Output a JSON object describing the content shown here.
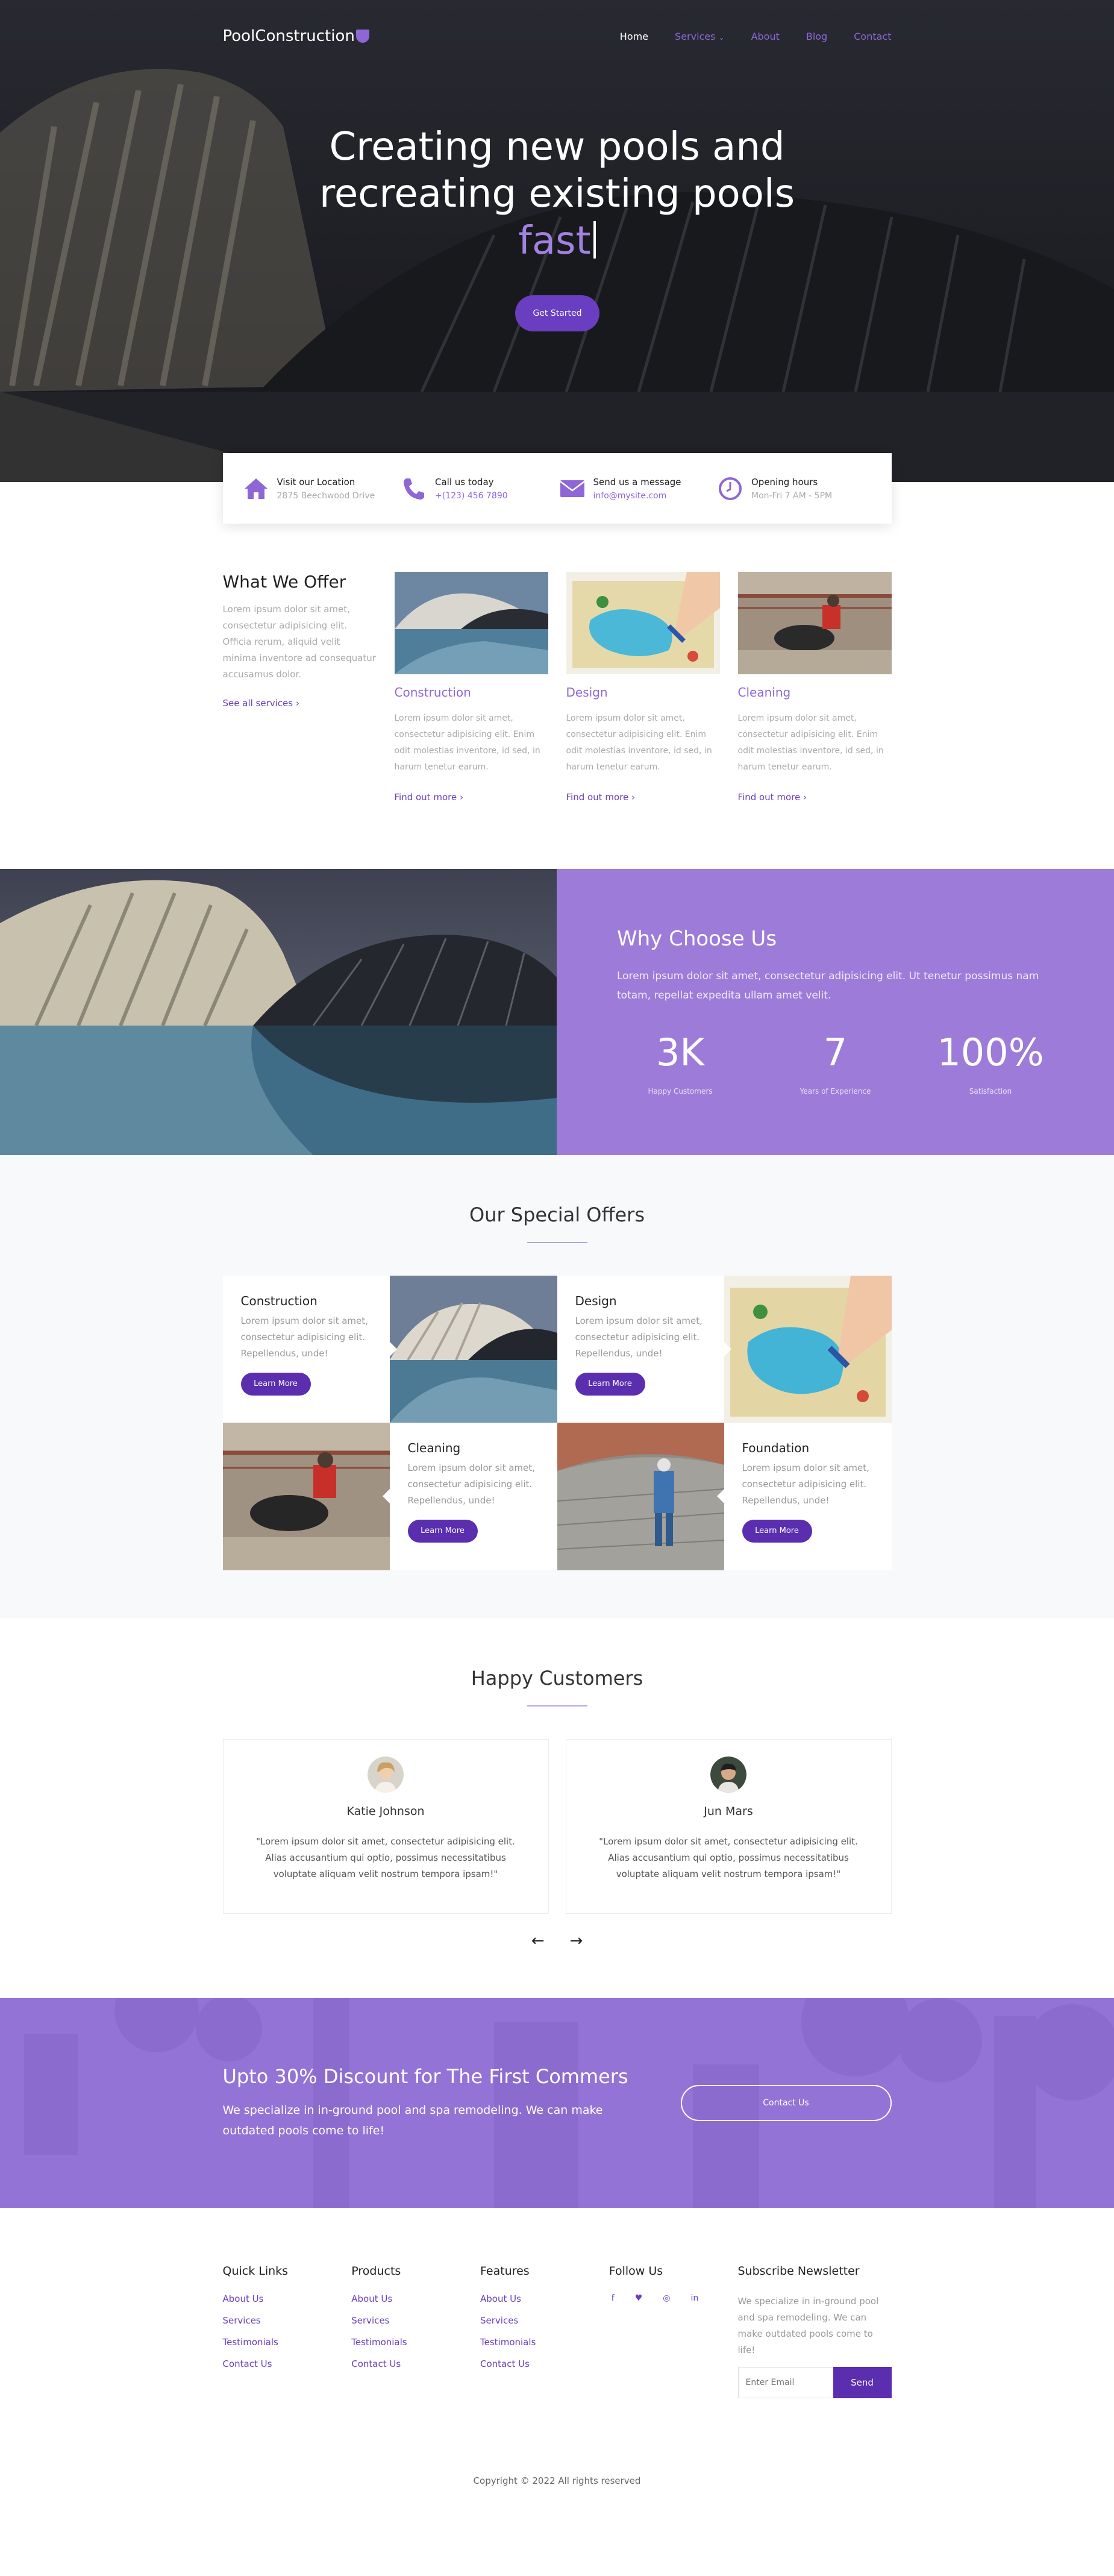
{
  "nav": {
    "logo": "PoolConstruction",
    "links": [
      {
        "label": "Home"
      },
      {
        "label": "Services"
      },
      {
        "label": "About"
      },
      {
        "label": "Blog"
      },
      {
        "label": "Contact"
      }
    ]
  },
  "hero": {
    "title_line1": "Creating new pools and",
    "title_line2": "recreating existing pools",
    "typed_word": "fast",
    "button": "Get Started"
  },
  "info_bar": [
    {
      "title": "Visit our Location",
      "sub": "2875 Beechwood Drive",
      "icon": "home-icon"
    },
    {
      "title": "Call us today",
      "sub": "+(123) 456 7890",
      "icon": "phone-icon"
    },
    {
      "title": "Send us a message",
      "sub": "info@mysite.com",
      "icon": "envelope-icon"
    },
    {
      "title": "Opening hours",
      "sub": "Mon-Fri 7 AM - 5PM",
      "icon": "clock-icon"
    }
  ],
  "offer": {
    "title": "What We Offer",
    "text": "Lorem ipsum dolor sit amet, consectetur adipisicing elit. Officia rerum, aliquid velit minima inventore ad consequatur accusamus dolor.",
    "link": "See all services",
    "services": [
      {
        "title": "Construction",
        "text": "Lorem ipsum dolor sit amet, consectetur adipisicing elit. Enim odit molestias inventore, id sed, in harum tenetur earum.",
        "link": "Find out more"
      },
      {
        "title": "Design",
        "text": "Lorem ipsum dolor sit amet, consectetur adipisicing elit. Enim odit molestias inventore, id sed, in harum tenetur earum.",
        "link": "Find out more"
      },
      {
        "title": "Cleaning",
        "text": "Lorem ipsum dolor sit amet, consectetur adipisicing elit. Enim odit molestias inventore, id sed, in harum tenetur earum.",
        "link": "Find out more"
      }
    ]
  },
  "why": {
    "title": "Why Choose Us",
    "text": "Lorem ipsum dolor sit amet, consectetur adipisicing elit. Ut tenetur possimus nam totam, repellat expedita ullam amet velit.",
    "stats": [
      {
        "value": "3K",
        "label": "Happy Customers"
      },
      {
        "value": "7",
        "label": "Years of Experience"
      },
      {
        "value": "100%",
        "label": "Satisfaction"
      }
    ]
  },
  "special": {
    "title": "Our Special Offers",
    "items": [
      {
        "title": "Construction",
        "text": "Lorem ipsum dolor sit amet, consectetur adipisicing elit. Repellendus, unde!",
        "button": "Learn More"
      },
      {
        "title": "Design",
        "text": "Lorem ipsum dolor sit amet, consectetur adipisicing elit. Repellendus, unde!",
        "button": "Learn More"
      },
      {
        "title": "Cleaning",
        "text": "Lorem ipsum dolor sit amet, consectetur adipisicing elit. Repellendus, unde!",
        "button": "Learn More"
      },
      {
        "title": "Foundation",
        "text": "Lorem ipsum dolor sit amet, consectetur adipisicing elit. Repellendus, unde!",
        "button": "Learn More"
      }
    ]
  },
  "customers": {
    "title": "Happy Customers",
    "testimonials": [
      {
        "name": "Katie Johnson",
        "quote": "\"Lorem ipsum dolor sit amet, consectetur adipisicing elit. Alias accusantium qui optio, possimus necessitatibus voluptate aliquam velit nostrum tempora ipsam!\""
      },
      {
        "name": "Jun Mars",
        "quote": "\"Lorem ipsum dolor sit amet, consectetur adipisicing elit. Alias accusantium qui optio, possimus necessitatibus voluptate aliquam velit nostrum tempora ipsam!\""
      }
    ],
    "prev": "←",
    "next": "→"
  },
  "cta": {
    "title": "Upto 30% Discount for The First Commers",
    "text": "We specialize in in-ground pool and spa remodeling. We can make outdated pools come to life!",
    "button": "Contact Us"
  },
  "footer": {
    "quick_links": {
      "title": "Quick Links",
      "items": [
        "About Us",
        "Services",
        "Testimonials",
        "Contact Us"
      ]
    },
    "products": {
      "title": "Products",
      "items": [
        "About Us",
        "Services",
        "Testimonials",
        "Contact Us"
      ]
    },
    "features": {
      "title": "Features",
      "items": [
        "About Us",
        "Services",
        "Testimonials",
        "Contact Us"
      ]
    },
    "follow": {
      "title": "Follow Us",
      "icons": [
        "f",
        "♥",
        "◎",
        "in"
      ]
    },
    "newsletter": {
      "title": "Subscribe Newsletter",
      "text": "We specialize in in-ground pool and spa remodeling. We can make outdated pools come to life!",
      "placeholder": "Enter Email",
      "button": "Send"
    },
    "copyright": "Copyright © 2022 All rights reserved"
  },
  "colors": {
    "accent": "#8e66d6",
    "accent_dark": "#5a2eaf",
    "why_bg": "#9d7bd9"
  }
}
